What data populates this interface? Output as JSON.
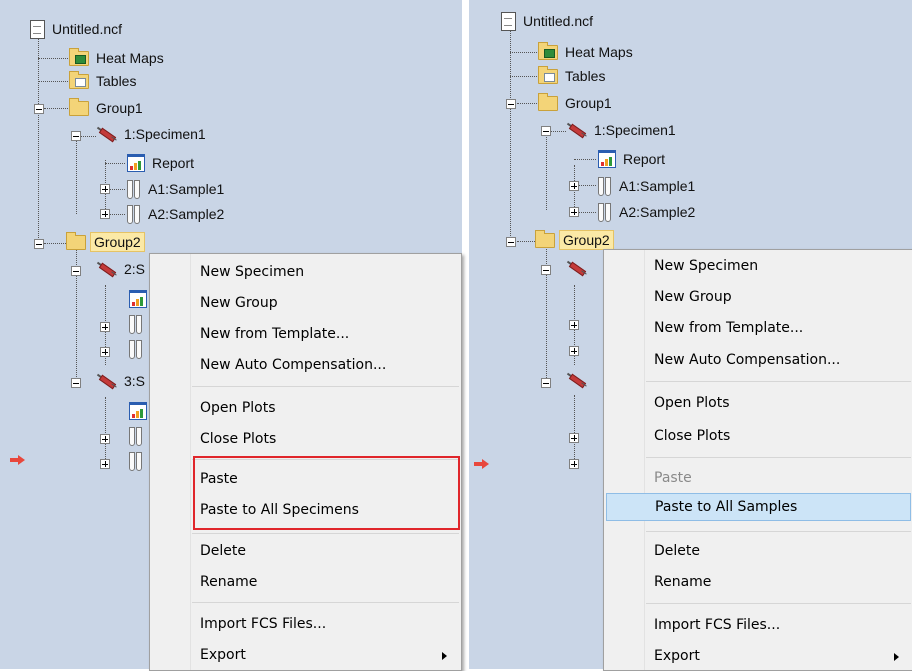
{
  "tree": {
    "root": "Untitled.ncf",
    "heat_maps": "Heat Maps",
    "tables": "Tables",
    "group1": "Group1",
    "specimen1": "1:Specimen1",
    "report": "Report",
    "sample1": "A1:Sample1",
    "sample2": "A2:Sample2",
    "group2_left": "Group2",
    "group2_right": "Group2",
    "specimen2_partial": "2:S",
    "specimen3_partial": "3:S"
  },
  "menu_left": {
    "new_specimen": "New Specimen",
    "new_group": "New Group",
    "new_from_template": "New from Template...",
    "new_auto_comp": "New Auto Compensation...",
    "open_plots": "Open Plots",
    "close_plots": "Close Plots",
    "paste": "Paste",
    "paste_to_all": "Paste to All Specimens",
    "delete": "Delete",
    "rename": "Rename",
    "import_fcs": "Import FCS Files...",
    "export": "Export"
  },
  "menu_right": {
    "new_specimen": "New Specimen",
    "new_group": "New Group",
    "new_from_template": "New from Template...",
    "new_auto_comp": "New Auto Compensation...",
    "open_plots": "Open Plots",
    "close_plots": "Close Plots",
    "paste": "Paste",
    "paste_to_all": "Paste to All Samples",
    "delete": "Delete",
    "rename": "Rename",
    "import_fcs": "Import FCS Files...",
    "export": "Export"
  },
  "icons": [
    "document-icon",
    "heatmap-folder-icon",
    "table-folder-icon",
    "folder-icon",
    "syringe-icon",
    "report-icon",
    "tube-icon",
    "expander-icon",
    "submenu-arrow-icon",
    "red-arrow-icon"
  ],
  "colors": {
    "panel_bg": "#c9d5e6",
    "menu_bg": "#f0f0f0",
    "highlight_border": "#e0262b",
    "hover_bg": "#cce4f7",
    "selected_node_bg": "#fbe9a6",
    "disabled_text": "#8a8a8a"
  }
}
